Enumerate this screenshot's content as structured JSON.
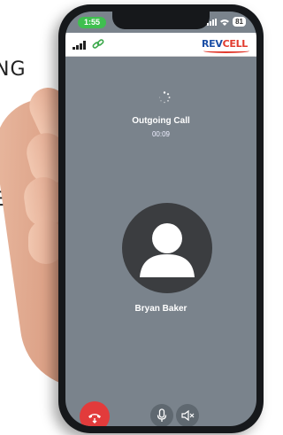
{
  "background_text": {
    "line1": "NG",
    "line2": "E"
  },
  "statusbar": {
    "time": "1:55",
    "battery": "81"
  },
  "header": {
    "logo_rev": "REV",
    "logo_cell": "CELL"
  },
  "call": {
    "status": "Outgoing Call",
    "duration": "00:09",
    "contact_name": "Bryan Baker"
  },
  "icons": {
    "hangup": "phone-hangup-icon",
    "mic": "microphone-icon",
    "speaker": "speaker-mute-icon",
    "avatar": "user-silhouette-icon",
    "spinner": "loading-spinner-icon"
  },
  "colors": {
    "screen_bg": "#7a838c",
    "hangup": "#e23b3b",
    "time_pill": "#3fbf4f",
    "logo_blue": "#1b4fa6",
    "logo_red": "#e23b2e"
  }
}
